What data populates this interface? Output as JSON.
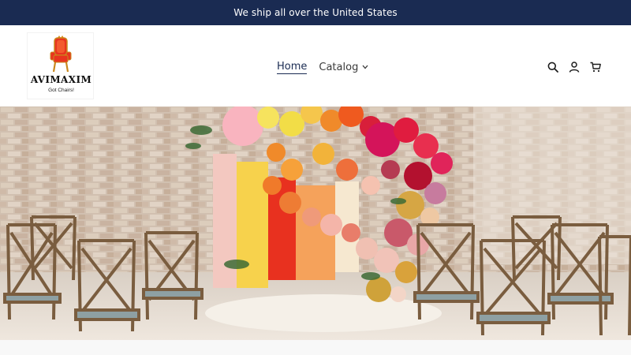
{
  "announcement": {
    "text": "We ship all over the United States"
  },
  "header": {
    "logo": {
      "brand": "AVIMAXIM",
      "tagline": "Got Chairs!"
    },
    "nav": {
      "home_label": "Home",
      "catalog_label": "Catalog"
    },
    "icons": [
      "search-icon",
      "account-icon",
      "cart-icon"
    ]
  },
  "hero": {
    "subject": "wedding ceremony with balloon arch and crossback chairs"
  },
  "colors": {
    "announcement_bg": "#1a2b52",
    "accent": "#1a2b52"
  }
}
